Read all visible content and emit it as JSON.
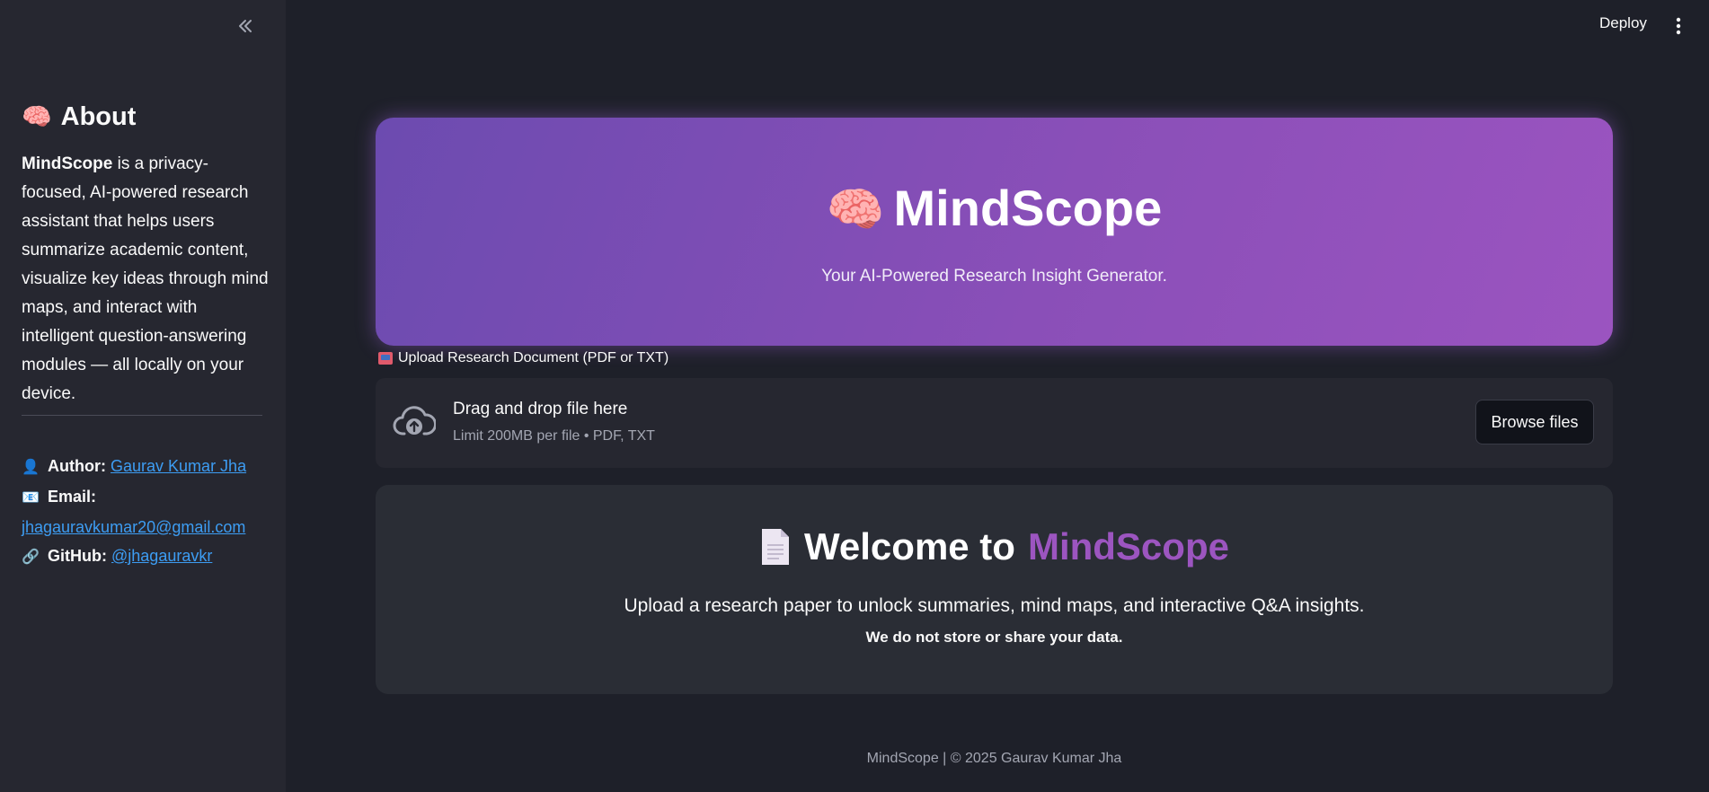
{
  "sidebar": {
    "about_emoji": "🧠",
    "about_title": "About",
    "about_bold": "MindScope",
    "about_text": " is a privacy-focused, AI-powered research assistant that helps users summarize academic content, visualize key ideas through mind maps, and interact with intelligent question-answering modules — all locally on your device.",
    "author_emoji": "👤",
    "author_label": "Author:",
    "author_name": "Gaurav Kumar Jha",
    "email_emoji": "📧",
    "email_label": "Email:",
    "email_value": "jhagauravkumar20@gmail.com",
    "github_emoji": "🔗",
    "github_label": "GitHub:",
    "github_value": "@jhagauravkr"
  },
  "toolbar": {
    "deploy_label": "Deploy"
  },
  "hero": {
    "emoji": "🧠",
    "title": "MindScope",
    "subtitle": "Your AI-Powered Research Insight Generator."
  },
  "uploader": {
    "label": "Upload Research Document (PDF or TXT)",
    "drop_title": "Drag and drop file here",
    "drop_limit": "Limit 200MB per file • PDF, TXT",
    "browse_label": "Browse files"
  },
  "welcome": {
    "title_prefix": "Welcome to",
    "title_accent": "MindScope",
    "subtitle": "Upload a research paper to unlock summaries, mind maps, and interactive Q&A insights.",
    "note": "We do not store or share your data."
  },
  "footer": {
    "text": "MindScope | © 2025 Gaurav Kumar Jha"
  },
  "colors": {
    "accent": "#9c55c0",
    "link": "#3d9df3",
    "hero_gradient_start": "#6c4bb0",
    "hero_gradient_end": "#9b54c0"
  },
  "icons": [
    "collapse-sidebar-icon",
    "kebab-menu-icon",
    "cloud-upload-icon",
    "document-icon",
    "mailbox-icon"
  ]
}
